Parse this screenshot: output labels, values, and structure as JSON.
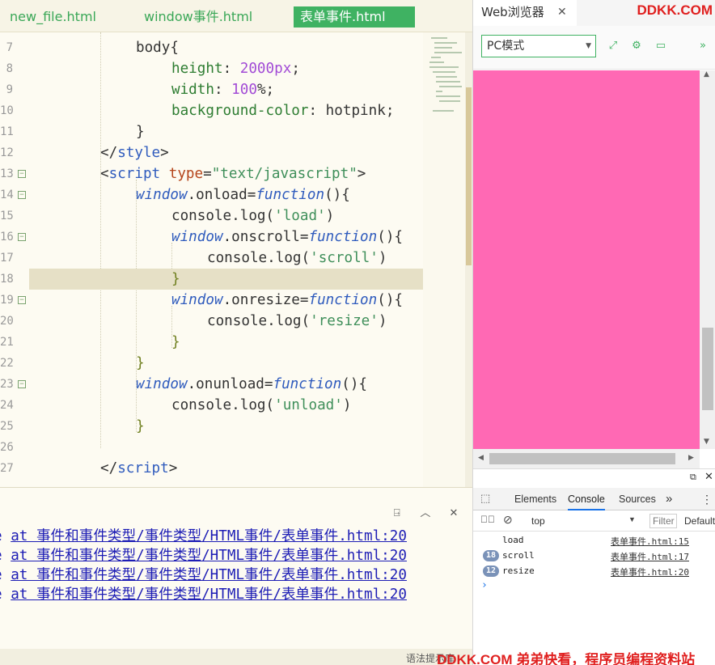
{
  "editor": {
    "tabs": [
      {
        "label": "new_file.html",
        "active": false
      },
      {
        "label": "window事件.html",
        "active": false
      },
      {
        "label": "表单事件.html",
        "active": true
      }
    ],
    "line_numbers": [
      "7",
      "8",
      "9",
      "10",
      "11",
      "12",
      "13",
      "14",
      "15",
      "16",
      "17",
      "18",
      "19",
      "20",
      "21",
      "22",
      "23",
      "24",
      "25",
      "26",
      "27"
    ],
    "fold_marker": "⊟",
    "code_lines": [
      {
        "line": "7",
        "indent": 12,
        "tokens": [
          {
            "t": "body{",
            "c": "t-bw"
          }
        ]
      },
      {
        "line": "8",
        "indent": 16,
        "tokens": [
          {
            "t": "height",
            "c": "t-kw"
          },
          {
            "t": ": ",
            "c": "t-pn"
          },
          {
            "t": "2000px",
            "c": "t-num"
          },
          {
            "t": ";",
            "c": "t-pn"
          }
        ]
      },
      {
        "line": "9",
        "indent": 16,
        "tokens": [
          {
            "t": "width",
            "c": "t-kw"
          },
          {
            "t": ": ",
            "c": "t-pn"
          },
          {
            "t": "100",
            "c": "t-num"
          },
          {
            "t": "%;",
            "c": "t-pn"
          }
        ]
      },
      {
        "line": "10",
        "indent": 16,
        "tokens": [
          {
            "t": "background-color",
            "c": "t-kw"
          },
          {
            "t": ": hotpink;",
            "c": "t-pn"
          }
        ]
      },
      {
        "line": "11",
        "indent": 12,
        "tokens": [
          {
            "t": "}",
            "c": "t-bw"
          }
        ]
      },
      {
        "line": "12",
        "indent": 8,
        "tokens": [
          {
            "t": "</",
            "c": "t-pn"
          },
          {
            "t": "style",
            "c": "t-tag"
          },
          {
            "t": ">",
            "c": "t-pn"
          }
        ]
      },
      {
        "line": "13",
        "indent": 8,
        "tokens": [
          {
            "t": "<",
            "c": "t-pn"
          },
          {
            "t": "script",
            "c": "t-tag"
          },
          {
            "t": " ",
            "c": "t-pn"
          },
          {
            "t": "type",
            "c": "t-attr"
          },
          {
            "t": "=",
            "c": "t-pn"
          },
          {
            "t": "\"text/javascript\"",
            "c": "t-str"
          },
          {
            "t": ">",
            "c": "t-pn"
          }
        ]
      },
      {
        "line": "14",
        "indent": 12,
        "tokens": [
          {
            "t": "window",
            "c": "t-win"
          },
          {
            "t": ".onload=",
            "c": "t-pn"
          },
          {
            "t": "function",
            "c": "t-fn"
          },
          {
            "t": "(){",
            "c": "t-pn"
          }
        ]
      },
      {
        "line": "15",
        "indent": 16,
        "tokens": [
          {
            "t": "console.log(",
            "c": "t-pn"
          },
          {
            "t": "'load'",
            "c": "t-str"
          },
          {
            "t": ")",
            "c": "t-pn"
          }
        ]
      },
      {
        "line": "16",
        "indent": 16,
        "tokens": [
          {
            "t": "window",
            "c": "t-win"
          },
          {
            "t": ".onscroll=",
            "c": "t-pn"
          },
          {
            "t": "function",
            "c": "t-fn"
          },
          {
            "t": "(){",
            "c": "t-pn"
          }
        ]
      },
      {
        "line": "17",
        "indent": 20,
        "tokens": [
          {
            "t": "console.log(",
            "c": "t-pn"
          },
          {
            "t": "'scroll'",
            "c": "t-str"
          },
          {
            "t": ")",
            "c": "t-pn"
          }
        ]
      },
      {
        "line": "18",
        "indent": 16,
        "tokens": [
          {
            "t": "}",
            "c": "t-brg"
          }
        ],
        "highlight": true
      },
      {
        "line": "19",
        "indent": 16,
        "tokens": [
          {
            "t": "window",
            "c": "t-win"
          },
          {
            "t": ".onresize=",
            "c": "t-pn"
          },
          {
            "t": "function",
            "c": "t-fn"
          },
          {
            "t": "(){",
            "c": "t-pn"
          }
        ]
      },
      {
        "line": "20",
        "indent": 20,
        "tokens": [
          {
            "t": "console.log(",
            "c": "t-pn"
          },
          {
            "t": "'resize'",
            "c": "t-str"
          },
          {
            "t": ")",
            "c": "t-pn"
          }
        ]
      },
      {
        "line": "21",
        "indent": 16,
        "tokens": [
          {
            "t": "}",
            "c": "t-brg"
          }
        ]
      },
      {
        "line": "22",
        "indent": 12,
        "tokens": [
          {
            "t": "}",
            "c": "t-brg"
          }
        ]
      },
      {
        "line": "23",
        "indent": 12,
        "tokens": [
          {
            "t": "window",
            "c": "t-win"
          },
          {
            "t": ".onunload=",
            "c": "t-pn"
          },
          {
            "t": "function",
            "c": "t-fn"
          },
          {
            "t": "(){",
            "c": "t-pn"
          }
        ]
      },
      {
        "line": "24",
        "indent": 16,
        "tokens": [
          {
            "t": "console.log(",
            "c": "t-pn"
          },
          {
            "t": "'unload'",
            "c": "t-str"
          },
          {
            "t": ")",
            "c": "t-pn"
          }
        ]
      },
      {
        "line": "25",
        "indent": 12,
        "tokens": [
          {
            "t": "}",
            "c": "t-brg"
          }
        ]
      },
      {
        "line": "26",
        "indent": 0,
        "tokens": []
      },
      {
        "line": "27",
        "indent": 8,
        "tokens": [
          {
            "t": "</",
            "c": "t-pn"
          },
          {
            "t": "script",
            "c": "t-tag"
          },
          {
            "t": ">",
            "c": "t-pn"
          }
        ]
      }
    ],
    "folded_lines": [
      "13",
      "14",
      "16",
      "19",
      "23"
    ]
  },
  "console_panel": {
    "icons": [
      "export-icon",
      "collapse-up-icon",
      "close-panel-icon"
    ],
    "log_lines": [
      {
        "prefix": "e ",
        "link": "at 事件和事件类型/事件类型/HTML事件/表单事件.html:20"
      },
      {
        "prefix": "e ",
        "link": "at 事件和事件类型/事件类型/HTML事件/表单事件.html:20"
      },
      {
        "prefix": "e ",
        "link": "at 事件和事件类型/事件类型/HTML事件/表单事件.html:20"
      },
      {
        "prefix": "e ",
        "link": "at 事件和事件类型/事件类型/HTML事件/表单事件.html:20"
      }
    ],
    "status_text": "语法提示库"
  },
  "browser": {
    "tab_label": "Web浏览器",
    "tab_close": "✕",
    "brand": "DDKK.COM",
    "mode": "PC模式",
    "toolbar_icons": [
      "open-external-icon",
      "settings-gear-icon",
      "terminal-icon",
      "more-chevron-icon"
    ],
    "viewport_color": "#ff69b4"
  },
  "devtools": {
    "tabs": [
      {
        "label": "Elements",
        "active": false
      },
      {
        "label": "Console",
        "active": true
      },
      {
        "label": "Sources",
        "active": false
      }
    ],
    "more": "»",
    "context": "top",
    "filter_placeholder": "Filter",
    "levels": "Default",
    "messages": [
      {
        "count": "",
        "text": "load",
        "source": "表单事件.html:15"
      },
      {
        "count": "18",
        "text": "scroll",
        "source": "表单事件.html:17"
      },
      {
        "count": "12",
        "text": "resize",
        "source": "表单事件.html:20"
      }
    ],
    "prompt": "›"
  },
  "watermark": "DDKK.COM 弟弟快看，程序员编程资料站"
}
